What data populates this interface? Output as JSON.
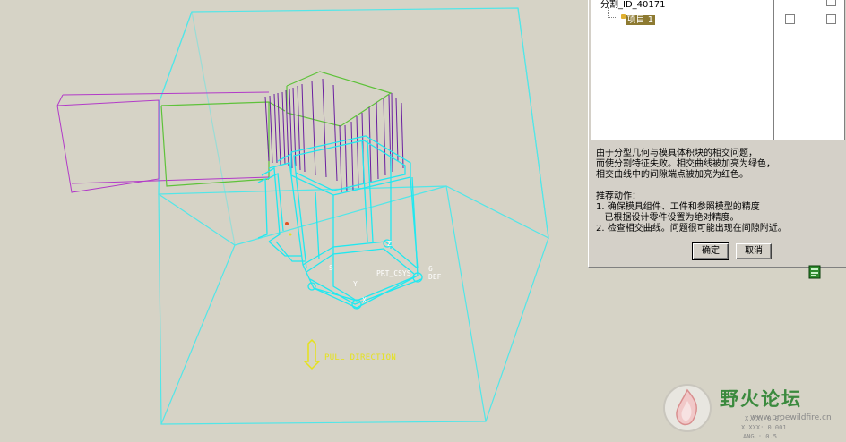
{
  "tree": {
    "root_label": "分割_ID_40171",
    "child_label": "项目 1"
  },
  "message": {
    "lines": [
      "由于分型几何与模具体积块的相交问题，",
      "而使分割特征失败。相交曲线被加亮为绿色，",
      "相交曲线中的间隙端点被加亮为红色。",
      "",
      "推荐动作：",
      "1. 确保模具组件、工件和参照模型的精度",
      "   已根据设计零件设置为绝对精度。",
      "2. 检查相交曲线。问题很可能出现在间隙附近。"
    ]
  },
  "buttons": {
    "ok": "确定",
    "cancel": "取消"
  },
  "viewport": {
    "pull_direction": "PULL DIRECTION",
    "csys_label": "PRT_CSYS",
    "def_label": "DEF",
    "s_label": "S",
    "six_label": "6",
    "x_label": "X",
    "y_label": "Y",
    "z_label": "Z"
  },
  "watermark": {
    "title": "野火论坛",
    "url": "www.proewildfire.cn",
    "stat1": "X.XX: 0.01",
    "stat2": "X.XXX: 0.001",
    "stat3": "ANG.: 0.5"
  },
  "colors": {
    "background": "#d6d3c6",
    "box_edges": "#52e6e8",
    "part_edges": "#20e8f0",
    "intersection": "#5ec23a",
    "hatch": "#6a1fa0",
    "pull_text": "#e6e21a"
  }
}
